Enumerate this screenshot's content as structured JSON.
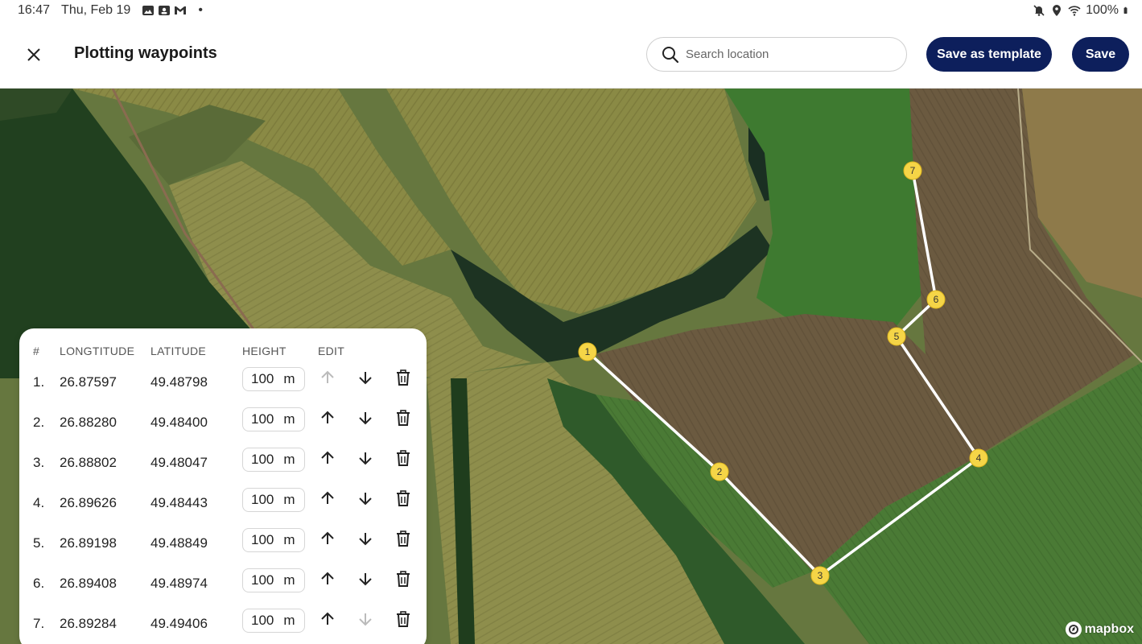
{
  "status_bar": {
    "time": "16:47",
    "date": "Thu, Feb 19",
    "notification_icons": [
      "photo-icon",
      "contact-card-icon",
      "gmail-icon"
    ],
    "dot": "•",
    "right_icons": [
      "mute-icon",
      "location-icon",
      "wifi-icon"
    ],
    "battery": "100%"
  },
  "toolbar": {
    "title": "Plotting waypoints",
    "search_placeholder": "Search location",
    "save_template_label": "Save as template",
    "save_label": "Save"
  },
  "map": {
    "attribution": "mapbox",
    "waypoint_color": "#f5d547",
    "route_color": "#ffffff",
    "waypoint_labels": [
      "1",
      "2",
      "3",
      "4",
      "5",
      "6",
      "7"
    ]
  },
  "panel": {
    "headers": {
      "index": "#",
      "longitude": "LONGTITUDE",
      "latitude": "LATITUDE",
      "height": "HEIGHT",
      "edit": "EDIT"
    },
    "rows": [
      {
        "index": "1.",
        "lon": "26.87597",
        "lat": "49.48798",
        "height": "100",
        "unit": "m",
        "up_enabled": false,
        "down_enabled": true
      },
      {
        "index": "2.",
        "lon": "26.88280",
        "lat": "49.48400",
        "height": "100",
        "unit": "m",
        "up_enabled": true,
        "down_enabled": true
      },
      {
        "index": "3.",
        "lon": "26.88802",
        "lat": "49.48047",
        "height": "100",
        "unit": "m",
        "up_enabled": true,
        "down_enabled": true
      },
      {
        "index": "4.",
        "lon": "26.89626",
        "lat": "49.48443",
        "height": "100",
        "unit": "m",
        "up_enabled": true,
        "down_enabled": true
      },
      {
        "index": "5.",
        "lon": "26.89198",
        "lat": "49.48849",
        "height": "100",
        "unit": "m",
        "up_enabled": true,
        "down_enabled": true
      },
      {
        "index": "6.",
        "lon": "26.89408",
        "lat": "49.48974",
        "height": "100",
        "unit": "m",
        "up_enabled": true,
        "down_enabled": true
      },
      {
        "index": "7.",
        "lon": "26.89284",
        "lat": "49.49406",
        "height": "100",
        "unit": "m",
        "up_enabled": true,
        "down_enabled": false
      }
    ]
  },
  "colors": {
    "primary_button": "#0d1f5c",
    "enabled_icon": "#222222",
    "disabled_icon": "#bbbbbb"
  }
}
